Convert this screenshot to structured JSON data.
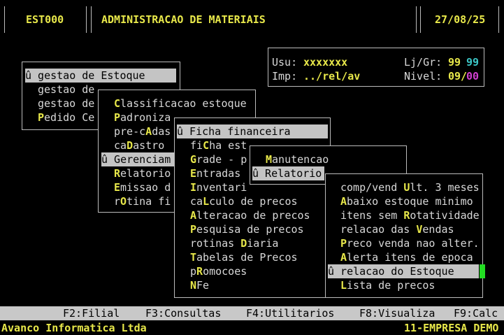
{
  "header": {
    "code": "EST000",
    "title": "ADMINISTRACAO DE MATERIAIS",
    "date": "27/08/25"
  },
  "info": {
    "usu_label": "Usu:",
    "usu_value": "xxxxxxx",
    "ljgr_label": "Lj/Gr:",
    "lj_value": "99",
    "gr_value": "99",
    "imp_label": "Imp:",
    "imp_value": "../rel/av",
    "nivel_label": "Nivel:",
    "nivel_a": "09",
    "nivel_sep": "/",
    "nivel_b": "00"
  },
  "menu1": {
    "selected": "û gestao de Estoque",
    "items": [
      "gestao de",
      "gestao de"
    ],
    "pedido_hot": "P",
    "pedido_rest": "edido Ce"
  },
  "menu2": {
    "items": [
      {
        "hot": "C",
        "rest": "lassificacao estoque"
      },
      {
        "hot": "P",
        "rest": "adroniza"
      },
      {
        "pre": "pre-c",
        "hot": "A",
        "rest": "das"
      },
      {
        "pre": "ca",
        "hot": "D",
        "rest": "astro"
      },
      {
        "hot": "R",
        "rest": "elatorio"
      },
      {
        "hot": "E",
        "rest": "missao d"
      },
      {
        "pre": "r",
        "hot": "O",
        "rest": "tina fi"
      }
    ],
    "selected": "û Gerenciam"
  },
  "menu3": {
    "selected": "û Ficha financeira",
    "items": [
      {
        "pre": "fi",
        "hot": "C",
        "rest": "ha est"
      },
      {
        "hot": "G",
        "rest": "rade - p"
      },
      {
        "hot": "E",
        "rest": "ntradas"
      },
      {
        "hot": "I",
        "rest": "nventari"
      },
      {
        "pre": "ca",
        "hot": "L",
        "rest": "culo de precos"
      },
      {
        "hot": "A",
        "rest": "lteracao de precos"
      },
      {
        "hot": "P",
        "rest": "esquisa de precos"
      },
      {
        "pre": "rotinas ",
        "hot": "D",
        "rest": "iaria"
      },
      {
        "hot": "T",
        "rest": "abelas de Precos"
      },
      {
        "pre": "p",
        "hot": "R",
        "rest": "omocoes"
      },
      {
        "hot": "N",
        "rest": "Fe"
      }
    ]
  },
  "menu4": {
    "item_hot": "M",
    "item_rest": "anutencao",
    "selected": "û Relatorio"
  },
  "menu5": {
    "items": [
      {
        "pre": "comp/vend ",
        "hot": "U",
        "rest": "lt. 3 meses"
      },
      {
        "hot": "A",
        "rest": "baixo estoque minimo"
      },
      {
        "pre": "itens sem ",
        "hot": "R",
        "rest": "otatividade"
      },
      {
        "pre": "relacao das ",
        "hot": "V",
        "rest": "endas"
      },
      {
        "hot": "P",
        "rest": "reco venda nao alter."
      },
      {
        "hot": "A",
        "rest": "lerta itens de epoca"
      },
      {
        "hot": "L",
        "rest": "ista de precos"
      }
    ],
    "selected": "û relacao do Estoque"
  },
  "fkeys": [
    "F2:Filial",
    "F3:Consultas",
    "F4:Utilitarios",
    "F8:Visualiza",
    "F9:Calc"
  ],
  "footer": {
    "company": "Avanco Informatica Ltda",
    "empresa": "11-EMPRESA DEMO"
  },
  "colors": {
    "highlight": "#e8e84a",
    "cyan": "#3cc8c8",
    "magenta": "#d040d0",
    "cursor": "#22dd22"
  }
}
